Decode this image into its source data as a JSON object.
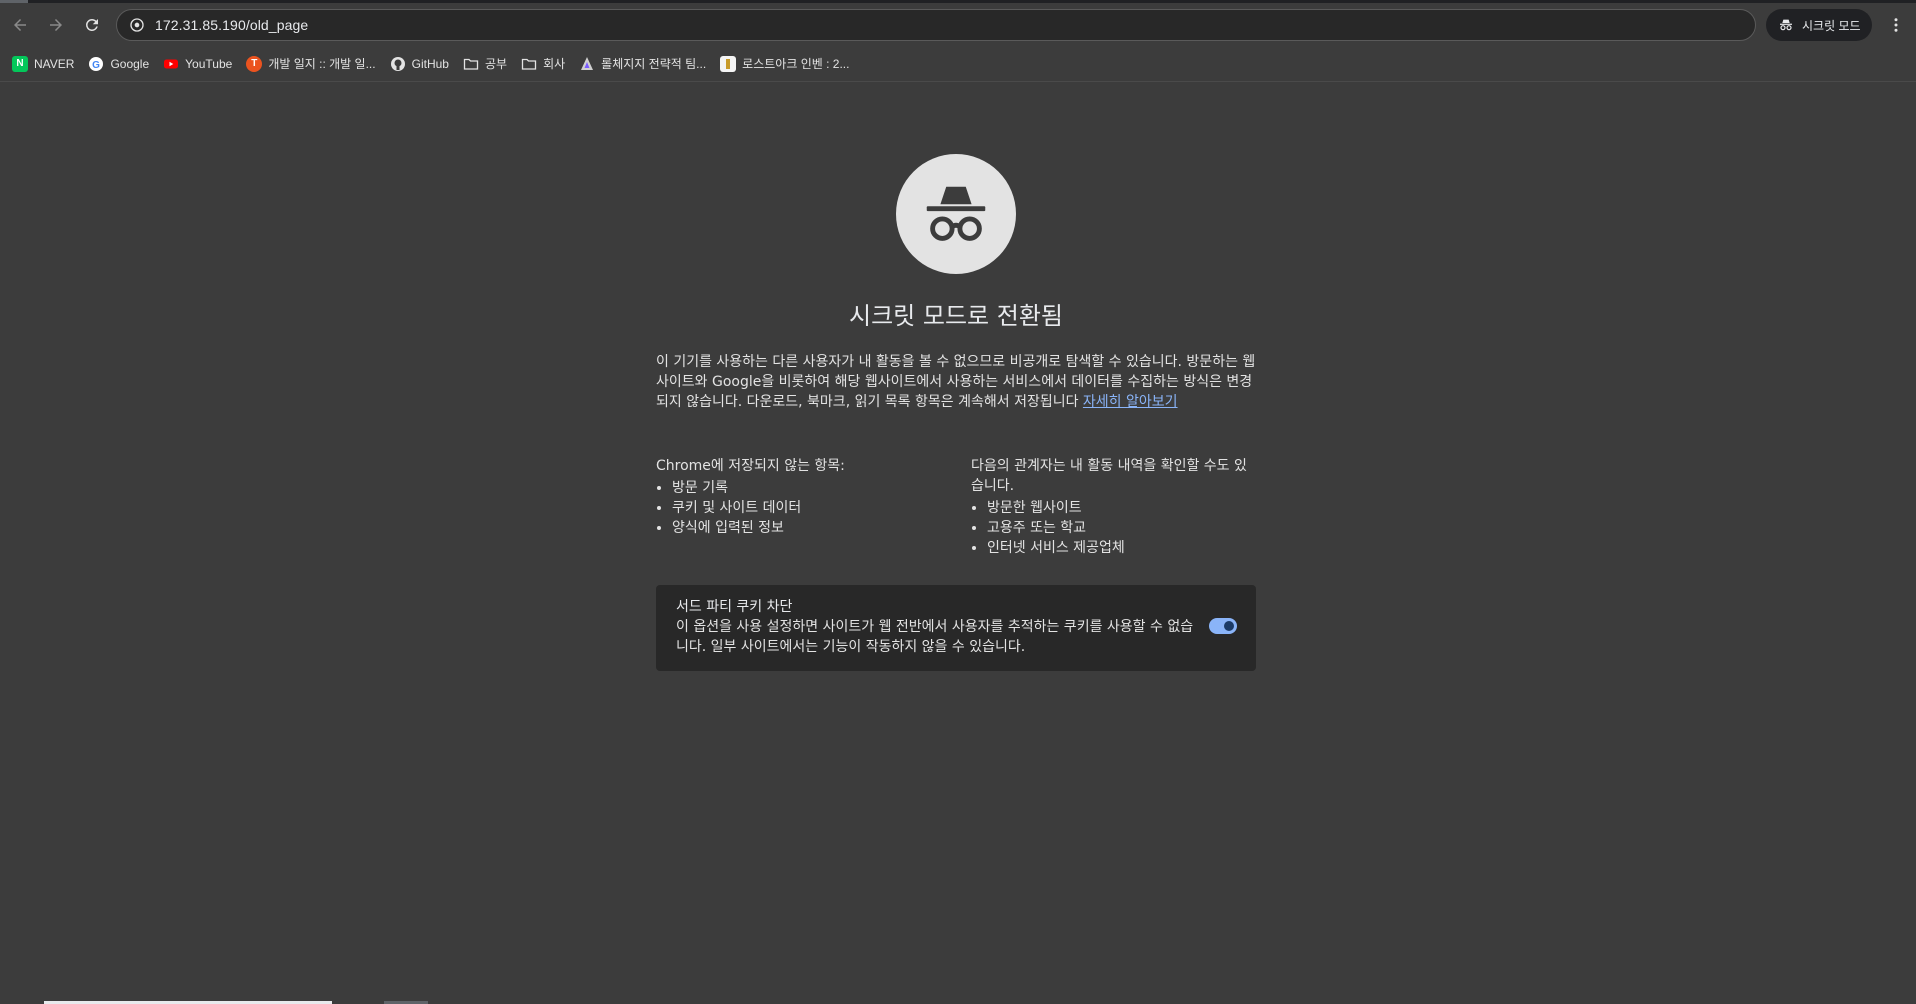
{
  "toolbar": {
    "url": "172.31.85.190/old_page",
    "incognito_label": "시크릿 모드"
  },
  "bookmarks": [
    {
      "label": "NAVER",
      "icon": "naver-icon",
      "color": "#03c75a"
    },
    {
      "label": "Google",
      "icon": "google-icon",
      "color": "#4285f4"
    },
    {
      "label": "YouTube",
      "icon": "youtube-icon",
      "color": "#ff0000"
    },
    {
      "label": "개발 일지 :: 개발 일...",
      "icon": "tistory-icon",
      "color": "#eb531f"
    },
    {
      "label": "GitHub",
      "icon": "github-icon",
      "color": "#e3e3e3"
    },
    {
      "label": "공부",
      "icon": "folder-icon"
    },
    {
      "label": "회사",
      "icon": "folder-icon"
    },
    {
      "label": "롤체지지 전략적 팀...",
      "icon": "lolchess-icon"
    },
    {
      "label": "로스트아크 인벤 : 2...",
      "icon": "inven-icon"
    }
  ],
  "page": {
    "title": "시크릿 모드로 전환됨",
    "intro": "이 기기를 사용하는 다른 사용자가 내 활동을 볼 수 없으므로 비공개로 탐색할 수 있습니다. 방문하는 웹사이트와 Google을 비롯하여 해당 웹사이트에서 사용하는 서비스에서 데이터를 수집하는 방식은 변경되지 않습니다. 다운로드, 북마크, 읽기 목록 항목은 계속해서 저장됩니다 ",
    "learn_more": "자세히 알아보기",
    "not_saved_heading": "Chrome에 저장되지 않는 항목:",
    "not_saved_items": [
      "방문 기록",
      "쿠키 및 사이트 데이터",
      "양식에 입력된 정보"
    ],
    "visible_heading": "다음의 관계자는 내 활동 내역을 확인할 수도 있습니다.",
    "visible_items": [
      "방문한 웹사이트",
      "고용주 또는 학교",
      "인터넷 서비스 제공업체"
    ],
    "cookie_title": "서드 파티 쿠키 차단",
    "cookie_desc": "이 옵션을 사용 설정하면 사이트가 웹 전반에서 사용자를 추적하는 쿠키를 사용할 수 없습니다. 일부 사이트에서는 기능이 작동하지 않을 수 있습니다.",
    "cookie_toggle_on": true
  },
  "colors": {
    "background": "#3c3c3c",
    "link": "#8ab4f8",
    "toggle_on": "#8ab4f8"
  }
}
